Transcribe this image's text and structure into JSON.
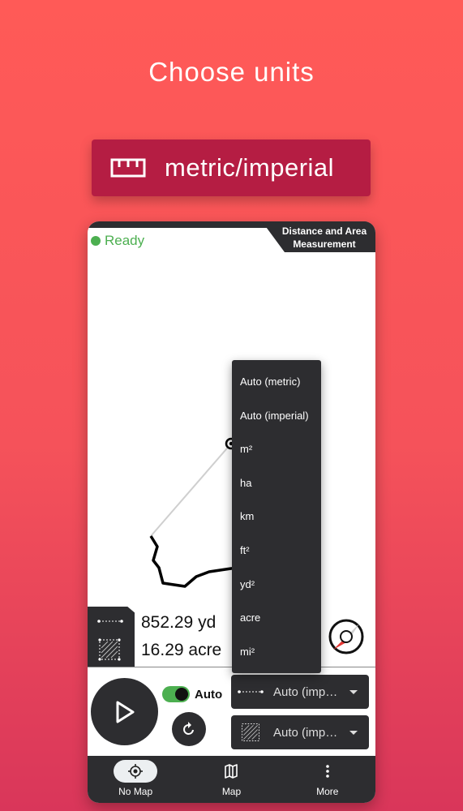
{
  "promo": {
    "headline": "Choose units",
    "badge_label": "metric/imperial",
    "badge_icon": "ruler-icon"
  },
  "app": {
    "title_line1": "Distance and Area",
    "title_line2": "Measurement",
    "status_text": "Ready",
    "status_color": "#4caf50",
    "distance_value": "852.29 yd",
    "area_value": "16.29 acre",
    "auto_label": "Auto",
    "auto_enabled": true,
    "distance_unit": "Auto (imp…",
    "area_unit": "Auto (imp…",
    "dropdown_options": [
      "Auto (metric)",
      "Auto (imperial)",
      "m²",
      "ha",
      "km",
      "ft²",
      "yd²",
      "acre",
      "mi²"
    ],
    "nav": [
      {
        "label": "No Map",
        "icon": "locate-icon",
        "active": true
      },
      {
        "label": "Map",
        "icon": "map-icon",
        "active": false
      },
      {
        "label": "More",
        "icon": "more-vert-icon",
        "active": false
      }
    ]
  },
  "colors": {
    "accent_dark": "#2d2d30",
    "badge_bg": "#b51d43",
    "toggle_on": "#4caf50",
    "compass_red": "#e53935"
  }
}
